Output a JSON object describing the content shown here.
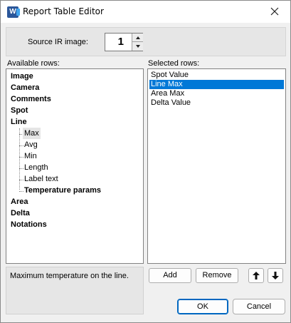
{
  "window": {
    "title": "Report Table Editor",
    "app_icon_letter": "W",
    "app_icon_color": "#2b579a"
  },
  "source": {
    "label": "Source IR image:",
    "value": "1"
  },
  "available": {
    "label": "Available rows:",
    "items": [
      {
        "label": "Image",
        "bold": true,
        "level": 0
      },
      {
        "label": "Camera",
        "bold": true,
        "level": 0
      },
      {
        "label": "Comments",
        "bold": true,
        "level": 0
      },
      {
        "label": "Spot",
        "bold": true,
        "level": 0
      },
      {
        "label": "Line",
        "bold": true,
        "level": 0
      },
      {
        "label": "Max",
        "bold": false,
        "level": 1,
        "highlighted": true
      },
      {
        "label": "Avg",
        "bold": false,
        "level": 1
      },
      {
        "label": "Min",
        "bold": false,
        "level": 1
      },
      {
        "label": "Length",
        "bold": false,
        "level": 1
      },
      {
        "label": "Label text",
        "bold": false,
        "level": 1
      },
      {
        "label": "Temperature params",
        "bold": true,
        "level": 1
      },
      {
        "label": "Area",
        "bold": true,
        "level": 0
      },
      {
        "label": "Delta",
        "bold": true,
        "level": 0
      },
      {
        "label": "Notations",
        "bold": true,
        "level": 0
      }
    ]
  },
  "selected": {
    "label": "Selected rows:",
    "items": [
      {
        "label": "Spot Value",
        "selected": false
      },
      {
        "label": "Line Max",
        "selected": true
      },
      {
        "label": "Area Max",
        "selected": false
      },
      {
        "label": "Delta Value",
        "selected": false
      }
    ],
    "selection_color": "#0078d7"
  },
  "description": {
    "text": "Maximum temperature on the line."
  },
  "buttons": {
    "add": "Add",
    "remove": "Remove",
    "move_up_icon": "arrow-up-icon",
    "move_down_icon": "arrow-down-icon",
    "ok": "OK",
    "cancel": "Cancel"
  }
}
